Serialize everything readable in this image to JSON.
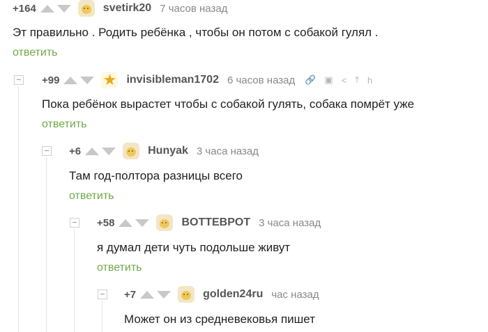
{
  "comments": [
    {
      "rating": "+164",
      "username": "svetirk20",
      "time": "7 часов назад",
      "text": "Эт правильно . Родить ребёнка , чтобы он потом с собакой гулял .",
      "reply": "ответить",
      "avatar": "face-avatar"
    },
    {
      "rating": "+99",
      "username": "invisibleman1702",
      "time": "6 часов назад",
      "text": "Пока ребёнок вырастет чтобы с собакой гулять, собака помрёт уже",
      "reply": "ответить",
      "avatar": "star-avatar",
      "tools": {
        "link": "🔗",
        "save": "▣",
        "share": "<",
        "up": "⤒",
        "h": "h"
      }
    },
    {
      "rating": "+6",
      "username": "Hunyak",
      "time": "3 часа назад",
      "text": "Там год-полтора разницы всего",
      "reply": "ответить",
      "avatar": "face-avatar"
    },
    {
      "rating": "+58",
      "username": "BOTTEBPOT",
      "time": "3 часа назад",
      "text": "я думал дети чуть подольше живут",
      "reply": "ответить",
      "avatar": "face-avatar"
    },
    {
      "rating": "+7",
      "username": "golden24ru",
      "time": "час назад",
      "text": "Может он из средневековья пишет",
      "reply": "",
      "avatar": "face-avatar"
    }
  ],
  "colors": {
    "reply": "#70a846",
    "muted": "#888888",
    "text": "#222222"
  }
}
